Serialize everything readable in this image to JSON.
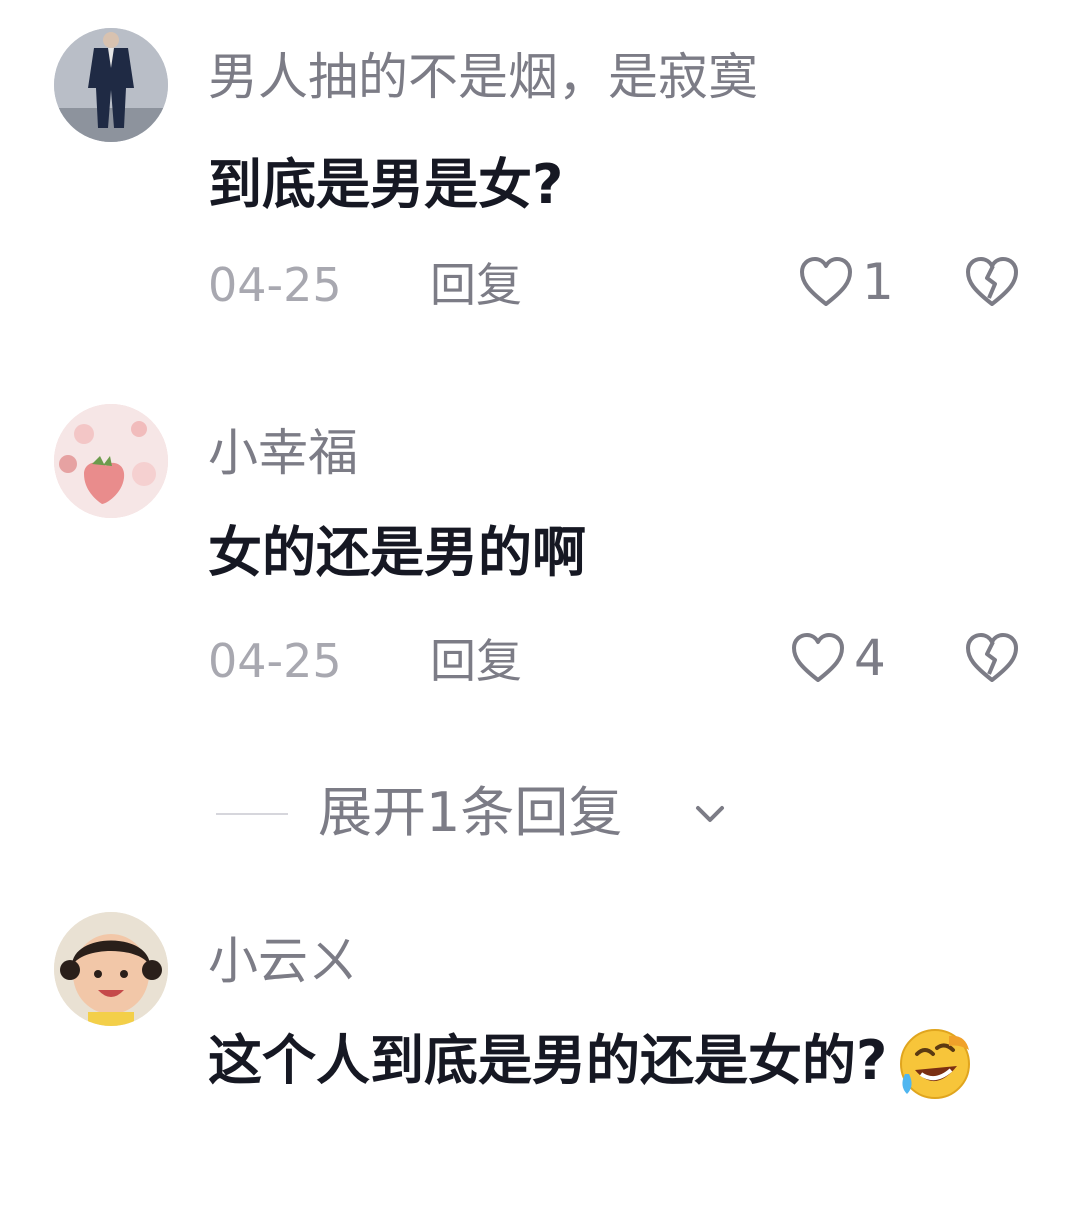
{
  "comments": [
    {
      "username": "男人抽的不是烟，是寂寞",
      "content": "到底是男是女?",
      "date": "04-25",
      "reply_label": "回复",
      "like_count": "1"
    },
    {
      "username": "小幸福",
      "content": "女的还是男的啊",
      "date": "04-25",
      "reply_label": "回复",
      "like_count": "4"
    },
    {
      "username": "小云ㄨ",
      "content": "这个人到底是男的还是女的?"
    }
  ],
  "expand_replies": {
    "label": "展开1条回复"
  },
  "icons": {
    "like": "heart-outline-icon",
    "dislike": "broken-heart-icon",
    "expand": "chevron-down-icon",
    "emoji": "rofl-emoji-icon"
  },
  "colors": {
    "text_primary": "#161823",
    "text_secondary": "#7c7c86",
    "text_tertiary": "#a8a8b0",
    "background": "#ffffff"
  }
}
